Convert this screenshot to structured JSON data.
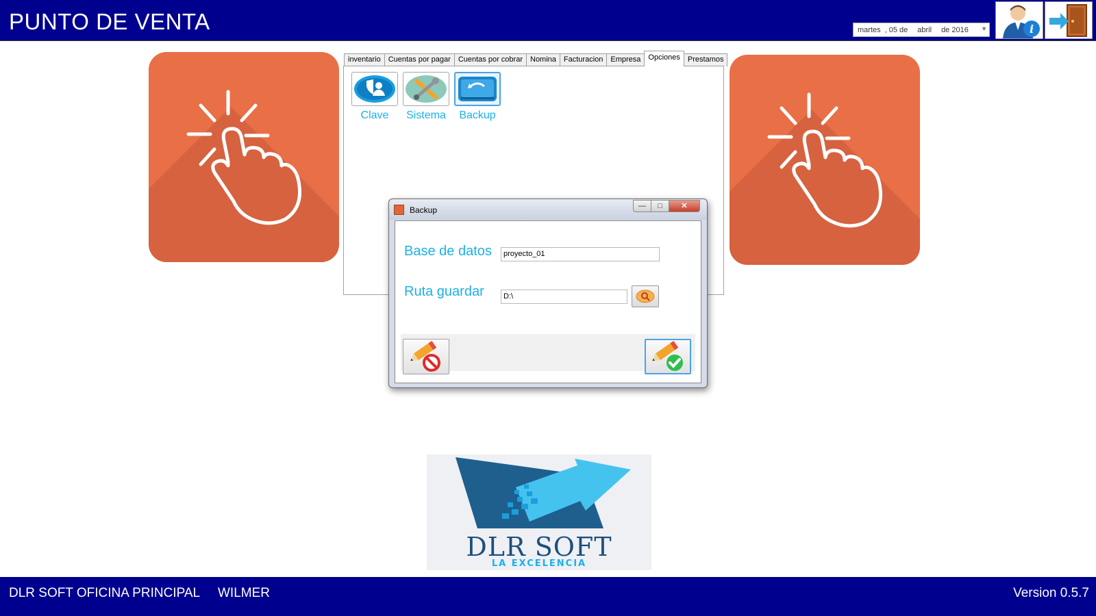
{
  "header": {
    "title": "PUNTO DE VENTA",
    "date": {
      "weekday": "martes",
      "day": ", 05 de",
      "month": "abril",
      "year": "de 2016"
    },
    "user_info_icon": "user-info-icon",
    "exit_icon": "exit-door-icon"
  },
  "tabs": [
    {
      "label": "inventario"
    },
    {
      "label": "Cuentas por pagar"
    },
    {
      "label": "Cuentas por cobrar"
    },
    {
      "label": "Nomina"
    },
    {
      "label": "Facturacion"
    },
    {
      "label": "Empresa"
    },
    {
      "label": "Opciones",
      "active": true
    },
    {
      "label": "Prestamos"
    }
  ],
  "options": {
    "clave": {
      "label": "Clave",
      "icon": "security-user-icon"
    },
    "sistema": {
      "label": "Sistema",
      "icon": "tools-icon"
    },
    "backup": {
      "label": "Backup",
      "icon": "backup-drive-icon"
    }
  },
  "dialog": {
    "title": "Backup",
    "database_label": "Base de datos",
    "database_value": "proyecto_01",
    "path_label": "Ruta guardar",
    "path_value": "D:\\",
    "minimize": "—",
    "maximize": "□",
    "close": "✕"
  },
  "logo": {
    "brand": "DLR SOFT",
    "slogan": "LA EXCELENCIA"
  },
  "footer": {
    "office": "DLR SOFT OFICINA PRINCIPAL",
    "user": "WILMER",
    "version": "Version 0.5.7"
  },
  "colors": {
    "header_bg": "#00008f",
    "tile_orange": "#e96f47",
    "accent_cyan": "#1ab0e8"
  }
}
